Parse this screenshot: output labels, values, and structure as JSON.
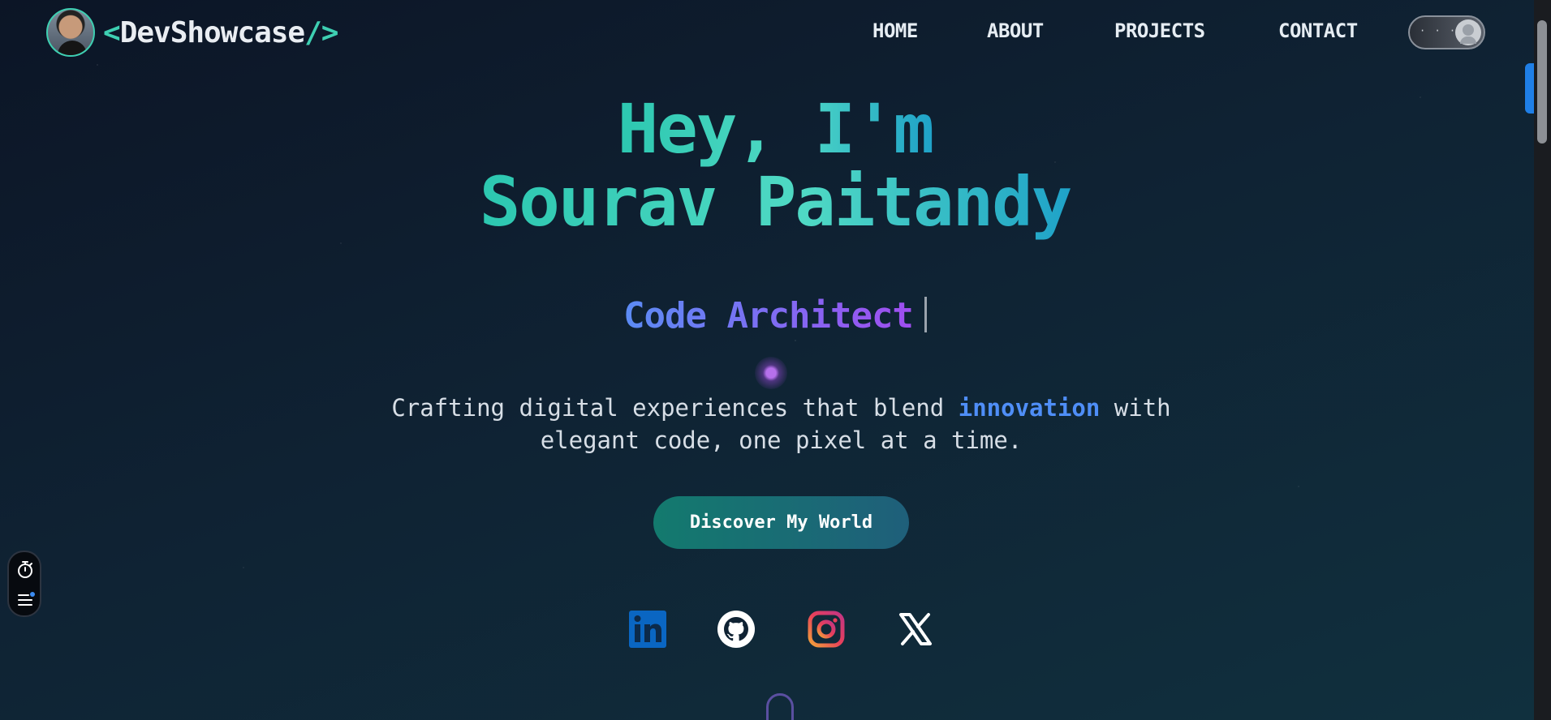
{
  "brand": {
    "open": "<",
    "name": "DevShowcase",
    "close": "/>"
  },
  "nav": {
    "items": [
      "HOME",
      "ABOUT",
      "PROJECTS",
      "CONTACT"
    ],
    "theme_toggle_icon": "user-moon-icon"
  },
  "hero": {
    "line1": "Hey, I'm",
    "line2": "Sourav Paitandy",
    "role": "Code Architect",
    "desc_pre": "Crafting digital experiences that blend ",
    "desc_highlight": "innovation",
    "desc_post": " with",
    "desc_line2": "elegant code, one pixel at a time.",
    "cta": "Discover My World"
  },
  "social": [
    "linkedin-icon",
    "github-icon",
    "instagram-icon",
    "x-icon"
  ],
  "widget": [
    "timer-icon",
    "menu-icon"
  ],
  "colors": {
    "accent_teal": "#3ecfb2",
    "accent_blue": "#4f8ef7",
    "accent_purple": "#a04ef0",
    "cta_start": "#137a6e",
    "cta_end": "#1f5f7a"
  }
}
